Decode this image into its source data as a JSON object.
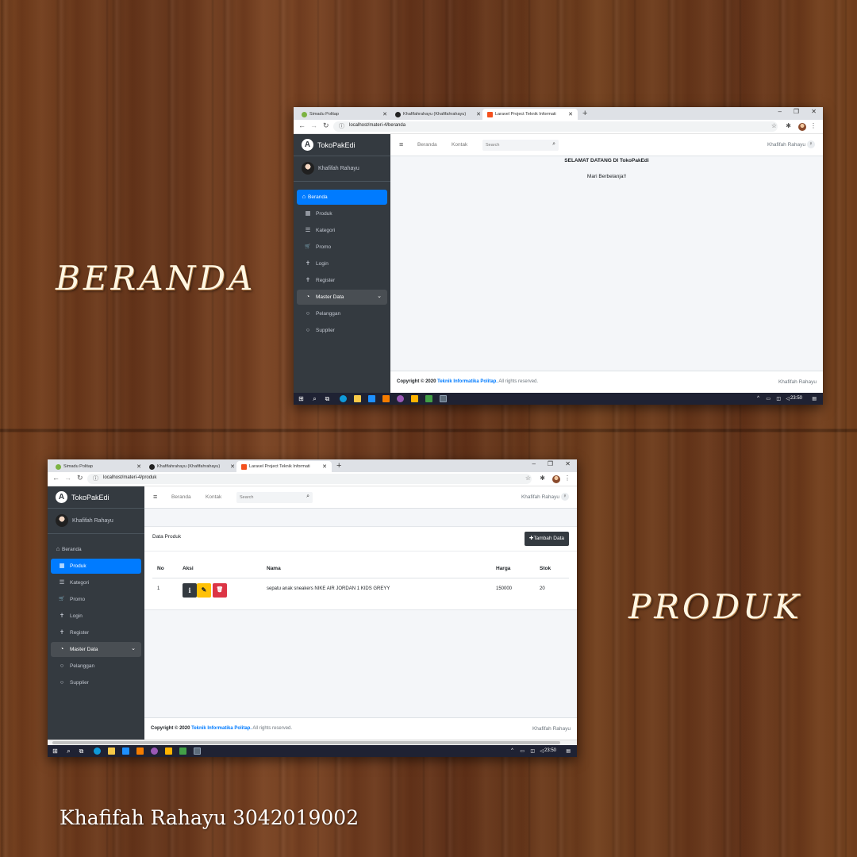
{
  "decor": {
    "title_beranda": "BERANDA",
    "title_produk": "PRODUK",
    "credit": "Khafifah Rahayu  3042019002"
  },
  "browser": {
    "tabs": [
      {
        "label": "Simadu Politap",
        "favicon": "green-circle"
      },
      {
        "label": "Khafifahrahayu (Khafifahrahayu)",
        "favicon": "github-icon"
      },
      {
        "label": "Laravel Project Teknik Informati",
        "favicon": "laravel-icon"
      }
    ],
    "new_tab": "+",
    "window_controls": {
      "minimize": "–",
      "restore": "❐",
      "close": "✕"
    },
    "icons": {
      "back": "←",
      "forward": "→",
      "reload": "↻",
      "info": "ⓘ",
      "star": "☆",
      "puzzle": "✱",
      "menu": "⋮",
      "close_tab": "✕"
    }
  },
  "app": {
    "brand": "TokoPakEdi",
    "brand_letter": "A",
    "user_name": "Khafifah Rahayu",
    "sidebar": {
      "items": [
        {
          "label": "Beranda",
          "icon": "⌂"
        },
        {
          "label": "Produk",
          "icon": "▦"
        },
        {
          "label": "Kategori",
          "icon": "☰"
        },
        {
          "label": "Promo",
          "icon": "🛒"
        },
        {
          "label": "Login",
          "icon": "✝"
        },
        {
          "label": "Register",
          "icon": "✝"
        },
        {
          "label": "Master Data",
          "icon": "◔"
        },
        {
          "label": "Pelanggan",
          "icon": "○"
        },
        {
          "label": "Supplier",
          "icon": "○"
        }
      ],
      "chevron": "⌄"
    },
    "topnav": {
      "menu_icon": "≡",
      "links": [
        "Beranda",
        "Kontak"
      ],
      "search_placeholder": "Search",
      "search_icon": "⌕",
      "user": "Khafifah Rahayu",
      "user_icon": "♀"
    },
    "footer": {
      "prefix": "Copyright © 2020 ",
      "link": "Teknik Informatika Politap.",
      "suffix": " All rights reserved.",
      "right": "Khafifah Rahayu"
    }
  },
  "window_beranda": {
    "url": "localhost/materi-4/beranda",
    "active_nav": "Beranda",
    "heading": "SELAMAT DATANG DI TokoPakEdi",
    "subheading": "Mari Berbelanja!!"
  },
  "window_produk": {
    "url": "localhost/materi-4/produk",
    "active_nav": "Produk",
    "card_title": "Data Produk",
    "add_button": "Tambah Data",
    "add_icon": "✚",
    "table": {
      "headers": [
        "No",
        "Aksi",
        "Nama",
        "Harga",
        "Stok"
      ],
      "rows": [
        {
          "no": "1",
          "nama": "sepatu anak sneakers NIKE AIR JORDAN 1 KIDS GREYY",
          "harga": "150000",
          "stok": "20"
        }
      ],
      "action_icons": {
        "detail": "i",
        "edit": "✎",
        "delete": "🗑"
      }
    }
  },
  "taskbar": {
    "time": "23:50",
    "tray_caret": "^"
  },
  "colors": {
    "sidebar": "#343a40",
    "active": "#007bff",
    "group": "#494e53",
    "warning": "#ffc107",
    "danger": "#dc3545",
    "link": "#007bff",
    "taskbar": "#1f2233"
  }
}
